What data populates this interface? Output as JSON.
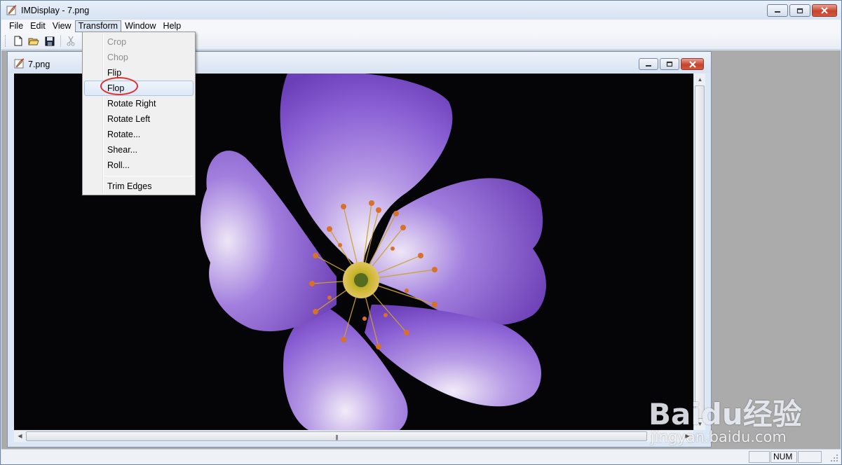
{
  "app": {
    "title": "IMDisplay - 7.png"
  },
  "menubar": {
    "items": [
      {
        "label": "File"
      },
      {
        "label": "Edit"
      },
      {
        "label": "View"
      },
      {
        "label": "Transform"
      },
      {
        "label": "Window"
      },
      {
        "label": "Help"
      }
    ]
  },
  "toolbar": {
    "buttons": [
      "new-document-icon",
      "open-folder-icon",
      "save-icon",
      "cut-icon"
    ]
  },
  "child_window": {
    "title": "7.png"
  },
  "transform_menu": {
    "items": [
      {
        "label": "Crop",
        "enabled": false
      },
      {
        "label": "Chop",
        "enabled": false
      },
      {
        "label": "Flip",
        "enabled": true
      },
      {
        "label": "Flop",
        "enabled": true,
        "highlighted": true
      },
      {
        "label": "Rotate Right",
        "enabled": true
      },
      {
        "label": "Rotate Left",
        "enabled": true
      },
      {
        "label": "Rotate...",
        "enabled": true
      },
      {
        "label": "Shear...",
        "enabled": true
      },
      {
        "label": "Roll...",
        "enabled": true
      },
      {
        "label": "Trim Edges",
        "enabled": true
      }
    ]
  },
  "statusbar": {
    "num": "NUM"
  },
  "watermark": {
    "logo": "Baidu经验",
    "url": "jingyan.baidu.com"
  },
  "colors": {
    "highlight_ring": "#e0312d",
    "petal": "#8e5fd6",
    "background": "#050508"
  }
}
